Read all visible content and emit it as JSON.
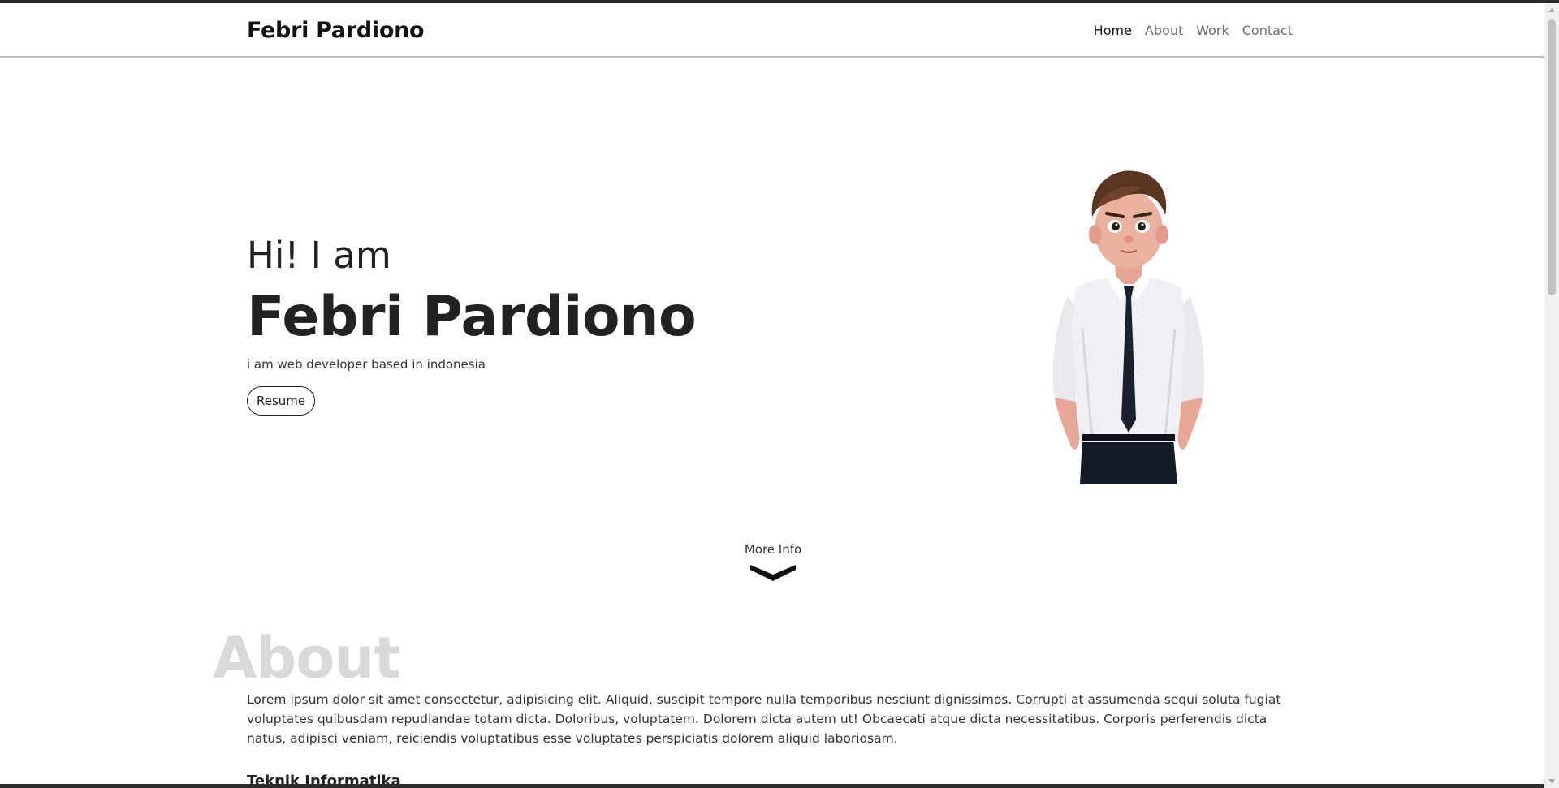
{
  "navbar": {
    "brand": "Febri Pardiono",
    "links": [
      {
        "label": "Home",
        "active": true
      },
      {
        "label": "About",
        "active": false
      },
      {
        "label": "Work",
        "active": false
      },
      {
        "label": "Contact",
        "active": false
      }
    ]
  },
  "hero": {
    "greeting": "Hi! I am",
    "name": "Febri Pardiono",
    "tagline": "i am web developer based in indonesia",
    "resume_label": "Resume"
  },
  "more_info": {
    "label": "More Info",
    "icon": "chevron-down-icon"
  },
  "about": {
    "title": "About",
    "text": "Lorem ipsum dolor sit amet consectetur, adipisicing elit. Aliquid, suscipit tempore nulla temporibus nesciunt dignissimos. Corrupti at assumenda sequi soluta fugiat voluptates quibusdam repudiandae totam dicta. Doloribus, voluptatem. Dolorem dicta autem ut! Obcaecati atque dicta necessitatibus. Corporis perferendis dicta natus, adipisci veniam, reiciendis voluptatibus esse voluptates perspiciatis dolorem aliquid laboriosam.",
    "subheading": "Teknik Informatika"
  },
  "colors": {
    "text": "#212529",
    "about_title": "#d9d9d9",
    "nav_inactive": "#6c6c6c"
  }
}
